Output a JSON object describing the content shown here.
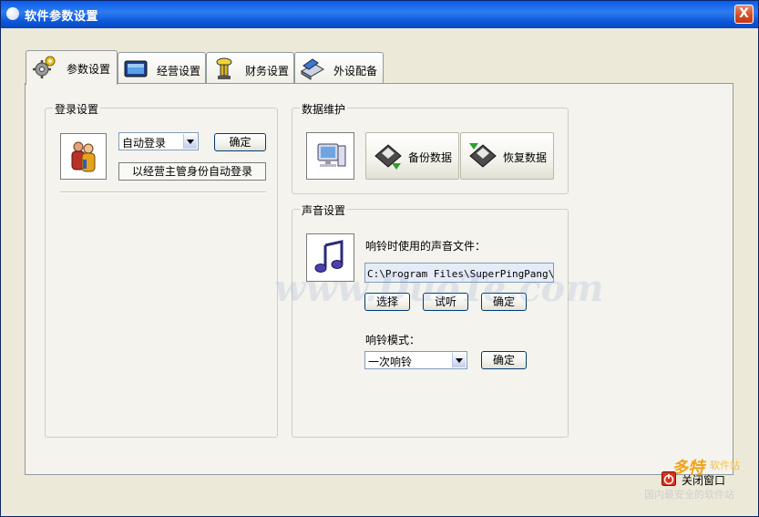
{
  "window": {
    "title": "软件参数设置",
    "close_glyph": "X"
  },
  "tabs": [
    {
      "label": "参数设置",
      "icon": "gears-icon",
      "active": true
    },
    {
      "label": "经营设置",
      "icon": "monitor-icon",
      "active": false
    },
    {
      "label": "财务设置",
      "icon": "tower-icon",
      "active": false
    },
    {
      "label": "外设配备",
      "icon": "scanner-icon",
      "active": false
    }
  ],
  "login": {
    "legend": "登录设置",
    "mode_selected": "自动登录",
    "confirm_label": "确定",
    "auto_button_label": "以经营主管身份自动登录"
  },
  "data_maintenance": {
    "legend": "数据维护",
    "backup_label": "备份数据",
    "restore_label": "恢复数据"
  },
  "sound": {
    "legend": "声音设置",
    "file_label": "响铃时使用的声音文件：",
    "file_path": "C:\\Program Files\\SuperPingPang\\Sho",
    "choose_label": "选择",
    "listen_label": "试听",
    "confirm_label": "确定",
    "mode_label": "响铃模式：",
    "mode_selected": "一次响铃",
    "mode_confirm_label": "确定"
  },
  "footer": {
    "close_label": "关闭窗口"
  },
  "watermark": {
    "text": "www.DuoTe.com"
  },
  "logo": {
    "brand": "多特",
    "suffix": "软件站",
    "slogan": "国内最安全的软件站"
  },
  "colors": {
    "titlebar": "#0a5ce9",
    "face": "#ece9d8",
    "panel": "#f4f3ee",
    "button_border": "#003c74"
  }
}
